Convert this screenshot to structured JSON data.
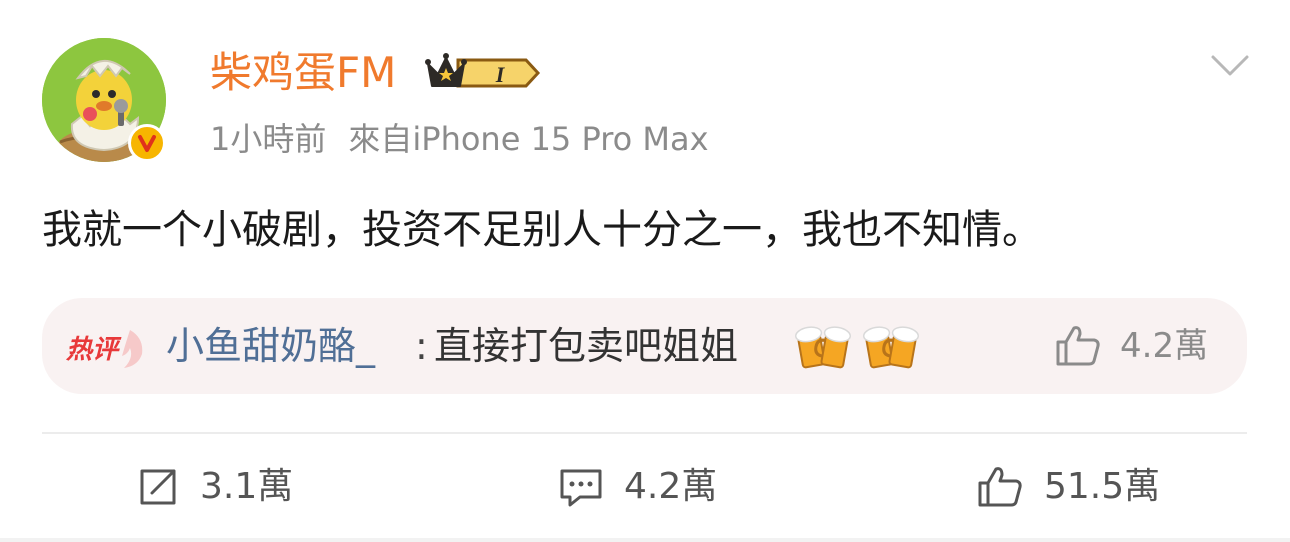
{
  "post": {
    "username": "柴鸡蛋FM",
    "vip_level": "I",
    "timestamp": "1小時前",
    "source": "來自iPhone 15 Pro Max",
    "content": "我就一个小破剧，投资不足别人十分之一，我也不知情。"
  },
  "hot_comment": {
    "tag": "热评",
    "user": "小鱼甜奶酪_",
    "colon": ":",
    "text": "直接打包卖吧姐姐",
    "emojis": [
      "beer-cheers-emoji",
      "beer-cheers-emoji"
    ],
    "likes": "4.2萬"
  },
  "actions": {
    "repost": "3.1萬",
    "comment": "4.2萬",
    "like": "51.5萬"
  },
  "colors": {
    "username": "#f07a2d",
    "hot_tag": "#e8393a",
    "comment_user": "#506f96",
    "hot_comment_bg": "#f9f2f2",
    "verify_badge": "#f7b500"
  },
  "icons": {
    "menu": "chevron-down-icon",
    "vip": "crown-icon",
    "verify": "verified-v-icon",
    "repost": "repost-icon",
    "comment": "comment-icon",
    "like": "thumbs-up-icon"
  }
}
